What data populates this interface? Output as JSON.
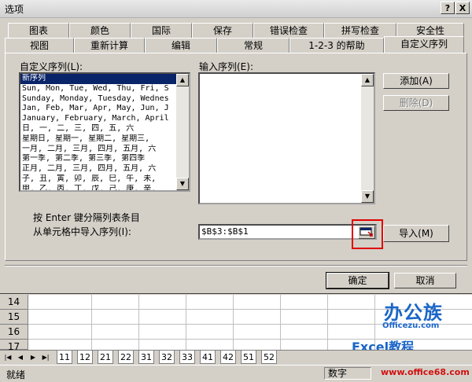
{
  "dialog": {
    "title": "选项",
    "help_button": "?",
    "close_button": "X"
  },
  "tabs_row1": [
    "图表",
    "颜色",
    "国际",
    "保存",
    "错误检查",
    "拼写检查",
    "安全性"
  ],
  "tabs_row2": [
    "视图",
    "重新计算",
    "编辑",
    "常规",
    "1-2-3 的帮助",
    "自定义序列"
  ],
  "active_tab": "自定义序列",
  "custom_lists": {
    "label": "自定义序列(L):",
    "items": [
      "新序列",
      "Sun, Mon, Tue, Wed, Thu, Fri, S",
      "Sunday, Monday, Tuesday, Wednes",
      "Jan, Feb, Mar, Apr, May, Jun, J",
      "January, February, March, April",
      "日, 一, 二, 三, 四, 五, 六",
      "星期日, 星期一, 星期二, 星期三,",
      "一月, 二月, 三月, 四月, 五月, 六",
      "第一季, 第二季, 第三季, 第四季",
      "正月, 二月, 三月, 四月, 五月, 六",
      "子, 丑, 寅, 卯, 辰, 巳, 午, 未,",
      "甲, 乙, 丙, 丁, 戊, 己, 庚, 辛,"
    ],
    "selected_index": 0
  },
  "entries": {
    "label": "输入序列(E):",
    "value": ""
  },
  "buttons": {
    "add": "添加(A)",
    "delete": "删除(D)",
    "import": "导入(M)",
    "ok": "确定",
    "cancel": "取消"
  },
  "hint": "按 Enter 键分隔列表条目",
  "import_label": "从单元格中导入序列(I):",
  "import_range": "$B$3:$B$1",
  "sheet": {
    "rows": [
      "14",
      "15",
      "16",
      "17"
    ],
    "tabs": [
      "11",
      "12",
      "21",
      "22",
      "31",
      "32",
      "33",
      "41",
      "42",
      "51",
      "52"
    ]
  },
  "status": {
    "ready": "就绪",
    "num": "数字"
  },
  "watermark": {
    "brand": "办公族",
    "url1": "Officezu.com",
    "excel": "Excel教程",
    "url2": "www.office68.com"
  }
}
